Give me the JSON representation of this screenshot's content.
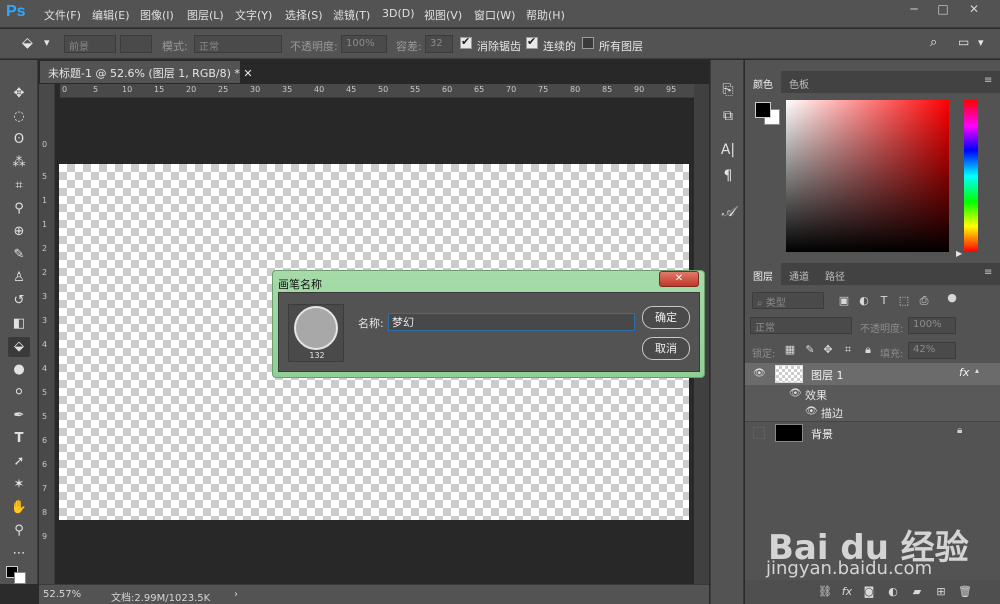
{
  "app": {
    "logo": "Ps",
    "menu": [
      "文件(F)",
      "编辑(E)",
      "图像(I)",
      "图层(L)",
      "文字(Y)",
      "选择(S)",
      "滤镜(T)",
      "3D(D)",
      "视图(V)",
      "窗口(W)",
      "帮助(H)"
    ],
    "window_controls": [
      "─",
      "□",
      "✕"
    ]
  },
  "options": {
    "tool_icon": "paint-bucket-icon",
    "fill_label": "前景",
    "mode_label": "模式:",
    "mode_value": "正常",
    "opacity_label": "不透明度:",
    "opacity_value": "100%",
    "tolerance_label": "容差:",
    "tolerance_value": "32",
    "antialias_label": "消除锯齿",
    "contiguous_label": "连续的",
    "all_layers_label": "所有图层"
  },
  "document": {
    "tab_title": "未标题-1 @ 52.6% (图层 1, RGB/8) *",
    "ruler_top": [
      "0",
      "5",
      "10",
      "15",
      "20",
      "25",
      "30",
      "35",
      "40",
      "45",
      "50",
      "55",
      "60",
      "65",
      "70",
      "75",
      "80",
      "85",
      "90",
      "95"
    ],
    "ruler_left": [
      "0",
      "5",
      "1",
      "1",
      "2",
      "2",
      "3",
      "3",
      "4",
      "4",
      "5",
      "5",
      "6",
      "6",
      "7",
      "8",
      "9"
    ],
    "zoom": "52.57%",
    "doc_info": "文档:2.99M/1023.5K"
  },
  "color_panel": {
    "tabs": [
      "颜色",
      "色板"
    ],
    "foreground": "#000000",
    "background": "#ffffff",
    "hue": "#ff0000"
  },
  "layers_panel": {
    "tabs": [
      "图层",
      "通道",
      "路径"
    ],
    "kind_label": "类型",
    "blend_mode": "正常",
    "opacity_label": "不透明度:",
    "opacity_value": "100%",
    "lock_label": "锁定:",
    "fill_label": "填充:",
    "fill_value": "42%",
    "layers": [
      {
        "name": "图层 1",
        "fx": "fx"
      },
      {
        "name": "效果"
      },
      {
        "name": "描边"
      },
      {
        "name": "背景"
      }
    ]
  },
  "dialog": {
    "title": "画笔名称",
    "brush_size": "132",
    "name_label": "名称:",
    "name_value": "梦幻",
    "ok_label": "确定",
    "cancel_label": "取消"
  },
  "watermark": {
    "logo_text": "Bai du 经验",
    "url": "jingyan.baidu.com"
  }
}
